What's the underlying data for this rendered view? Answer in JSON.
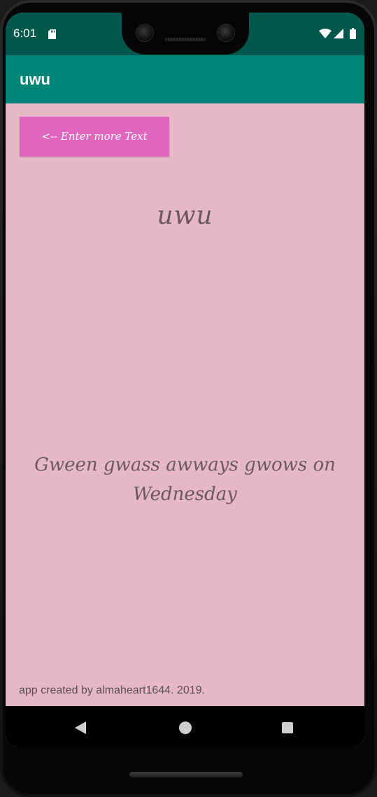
{
  "status_bar": {
    "time": "6:01",
    "icons": [
      "sd-card-icon",
      "wifi-icon",
      "signal-icon",
      "battery-icon"
    ]
  },
  "app_bar": {
    "title": "uwu"
  },
  "main": {
    "enter_button_label": "<-- Enter more Text",
    "heading": "uwu",
    "message": "Gween gwass awways gwows on Wednesday",
    "credits": "app created by almaheart1644. 2019."
  },
  "nav_bar": {
    "icons": [
      "back-icon",
      "home-icon",
      "recents-icon"
    ]
  },
  "colors": {
    "status_bar": "#00574b",
    "app_bar": "#008577",
    "background": "#e6b7c4",
    "button": "#e066c0",
    "text": "#6b5863"
  }
}
